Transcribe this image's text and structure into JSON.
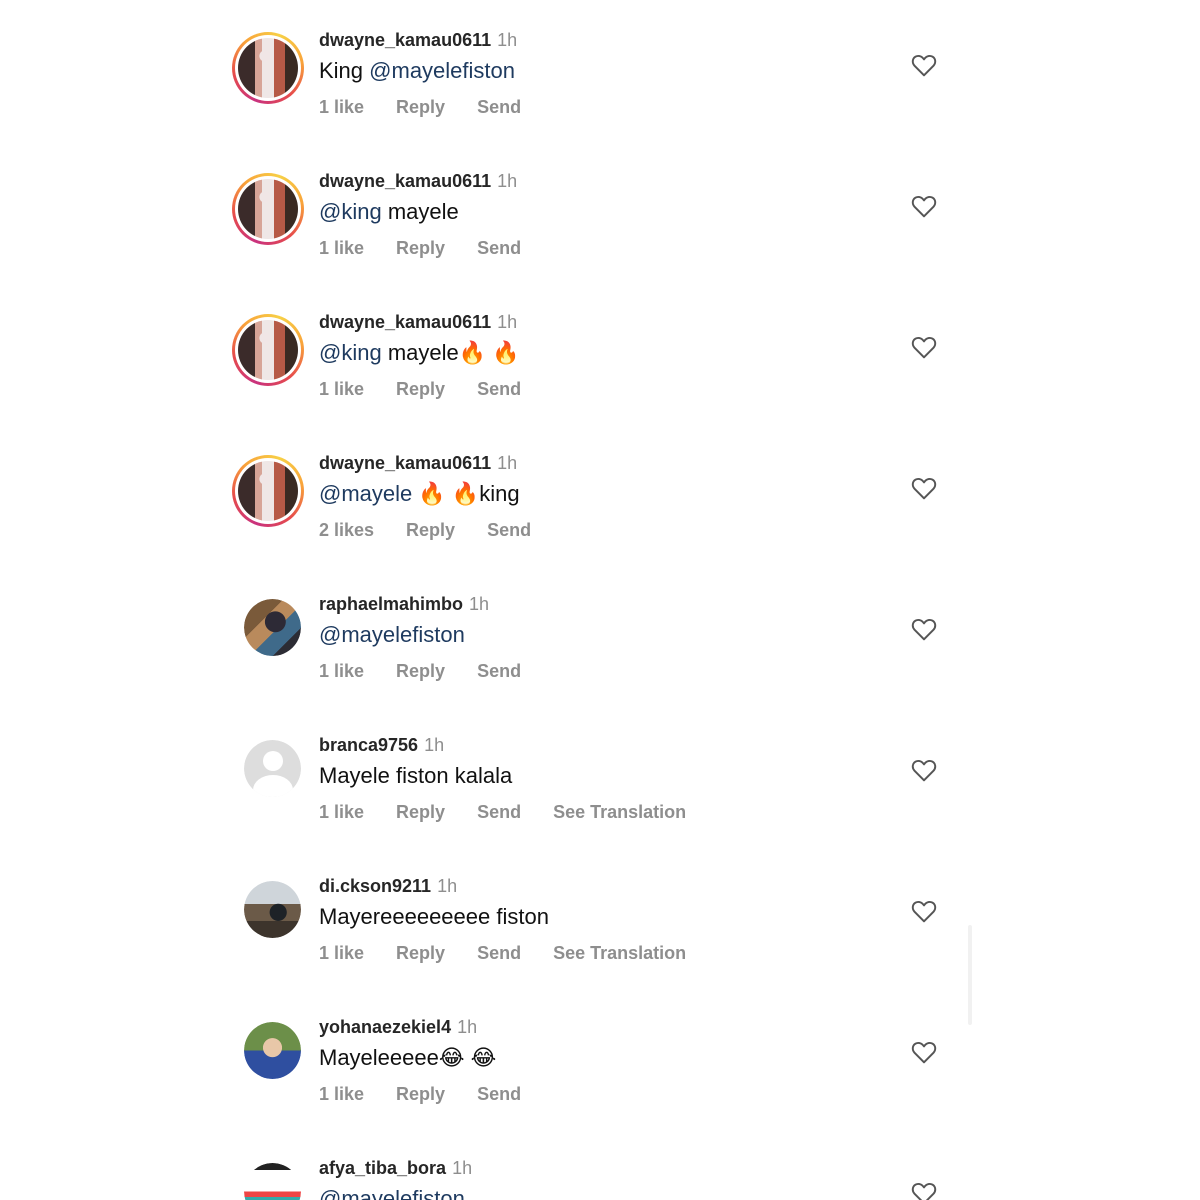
{
  "comments": [
    {
      "username": "dwayne_kamau0611",
      "time": "1h",
      "text_plain_before": "King ",
      "text_mention": "@mayelefiston",
      "text_plain_after": "",
      "likes": "1 like",
      "reply": "Reply",
      "send": "Send",
      "translate": ""
    },
    {
      "username": "dwayne_kamau0611",
      "time": "1h",
      "text_plain_before": "",
      "text_mention": "@king",
      "text_plain_after": " mayele",
      "likes": "1 like",
      "reply": "Reply",
      "send": "Send",
      "translate": ""
    },
    {
      "username": "dwayne_kamau0611",
      "time": "1h",
      "text_plain_before": "",
      "text_mention": "@king",
      "text_plain_after": " mayele🔥 🔥",
      "likes": "1 like",
      "reply": "Reply",
      "send": "Send",
      "translate": ""
    },
    {
      "username": "dwayne_kamau0611",
      "time": "1h",
      "text_plain_before": "",
      "text_mention": "@mayele",
      "text_plain_after": " 🔥 🔥king",
      "likes": "2 likes",
      "reply": "Reply",
      "send": "Send",
      "translate": ""
    },
    {
      "username": "raphaelmahimbo",
      "time": "1h",
      "text_plain_before": "",
      "text_mention": "@mayelefiston",
      "text_plain_after": "",
      "likes": "1 like",
      "reply": "Reply",
      "send": "Send",
      "translate": ""
    },
    {
      "username": "branca9756",
      "time": "1h",
      "text_plain_before": "Mayele fiston kalala",
      "text_mention": "",
      "text_plain_after": "",
      "likes": "1 like",
      "reply": "Reply",
      "send": "Send",
      "translate": "See Translation"
    },
    {
      "username": "di.ckson9211",
      "time": "1h",
      "text_plain_before": "Mayereeeeeeeee fiston",
      "text_mention": "",
      "text_plain_after": "",
      "likes": "1 like",
      "reply": "Reply",
      "send": "Send",
      "translate": "See Translation"
    },
    {
      "username": "yohanaezekiel4",
      "time": "1h",
      "text_plain_before": "Mayeleeeee😂 😂",
      "text_mention": "",
      "text_plain_after": "",
      "likes": "1 like",
      "reply": "Reply",
      "send": "Send",
      "translate": ""
    },
    {
      "username": "afya_tiba_bora",
      "time": "1h",
      "text_plain_before": "",
      "text_mention": "@mayelefiston",
      "text_plain_after": "",
      "likes": "",
      "reply": "",
      "send": "",
      "translate": ""
    }
  ],
  "icons": {
    "like": "heart-icon",
    "default_avatar": "default-avatar-icon"
  },
  "colors": {
    "username": "#262626",
    "meta": "#8e8e8e",
    "mention": "#1e3a5f"
  }
}
